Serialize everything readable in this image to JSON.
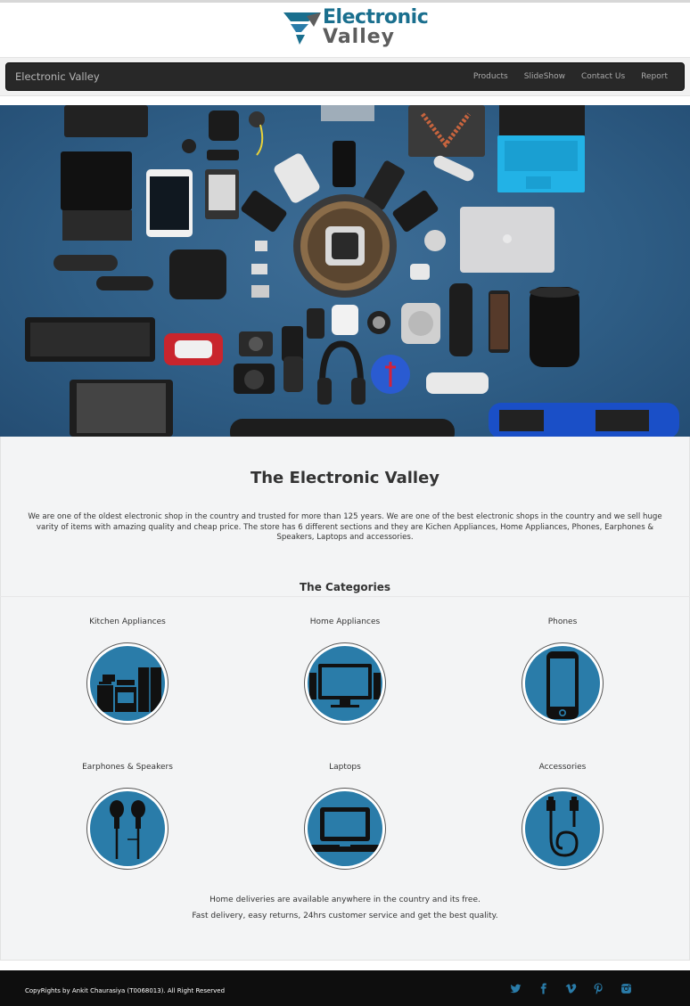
{
  "logo": {
    "word1": "Electronic",
    "word2": "Valley",
    "colors": {
      "primary": "#1a6f8e",
      "secondary": "#5d5d5d"
    }
  },
  "navbar": {
    "brand": "Electronic Valley",
    "links": [
      "Products",
      "SlideShow",
      "Contact Us",
      "Report"
    ]
  },
  "hero": {
    "background_color": "#2f5e86"
  },
  "main": {
    "title": "The Electronic Valley",
    "intro": "We are one of the oldest electronic shop in the country and trusted for more than 125 years. We are one of the best electronic shops in the country and we sell huge varity of items with amazing quality and cheap price. The store has 6 different sections and they are Kichen Appliances, Home Appliances, Phones, Earphones & Speakers, Laptops and accessories.",
    "categories_title": "The Categories",
    "categories": [
      {
        "label": "Kitchen Appliances",
        "icon": "kitchen-appliances-icon"
      },
      {
        "label": "Home Appliances",
        "icon": "television-icon"
      },
      {
        "label": "Phones",
        "icon": "phone-icon"
      },
      {
        "label": "Earphones & Speakers",
        "icon": "earphones-icon"
      },
      {
        "label": "Laptops",
        "icon": "laptop-icon"
      },
      {
        "label": "Accessories",
        "icon": "cable-icon"
      }
    ],
    "notes": [
      "Home deliveries are available anywhere in the country and its free.",
      "Fast delivery, easy returns, 24hrs customer service and get the best quality."
    ],
    "accent_color": "#2a7ca9"
  },
  "footer": {
    "copyright": "CopyRights by Ankit Chaurasiya (T0068013). All Right Reserved",
    "social": [
      "twitter-icon",
      "facebook-icon",
      "vimeo-icon",
      "pinterest-icon",
      "instagram-icon"
    ],
    "social_color": "#2a7ca9"
  }
}
